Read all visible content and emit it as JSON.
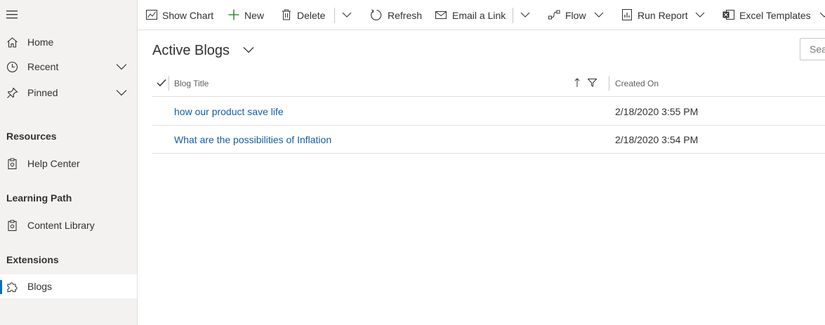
{
  "sidebar": {
    "items": [
      {
        "label": "Home",
        "icon": "home-icon"
      },
      {
        "label": "Recent",
        "icon": "clock-icon"
      },
      {
        "label": "Pinned",
        "icon": "pin-icon"
      }
    ],
    "sections": [
      {
        "heading": "Resources",
        "items": [
          {
            "label": "Help Center",
            "icon": "book-icon"
          }
        ]
      },
      {
        "heading": "Learning Path",
        "items": [
          {
            "label": "Content Library",
            "icon": "book-icon"
          }
        ]
      },
      {
        "heading": "Extensions",
        "items": [
          {
            "label": "Blogs",
            "icon": "puzzle-icon",
            "selected": true
          }
        ]
      }
    ]
  },
  "commandbar": {
    "show_chart": "Show Chart",
    "new": "New",
    "delete": "Delete",
    "refresh": "Refresh",
    "email_link": "Email a Link",
    "flow": "Flow",
    "run_report": "Run Report",
    "excel_templates": "Excel Templates"
  },
  "view": {
    "title": "Active Blogs",
    "search_placeholder": "Search this view"
  },
  "grid": {
    "columns": [
      "Blog Title",
      "Created On"
    ],
    "rows": [
      {
        "title": "how our product save life",
        "created_on": "2/18/2020 3:55 PM"
      },
      {
        "title": "What are the possibilities of Inflation",
        "created_on": "2/18/2020 3:54 PM"
      }
    ]
  },
  "colors": {
    "accent": "#0f6cbd",
    "link": "#115ea3",
    "new_plus": "#107c10"
  }
}
